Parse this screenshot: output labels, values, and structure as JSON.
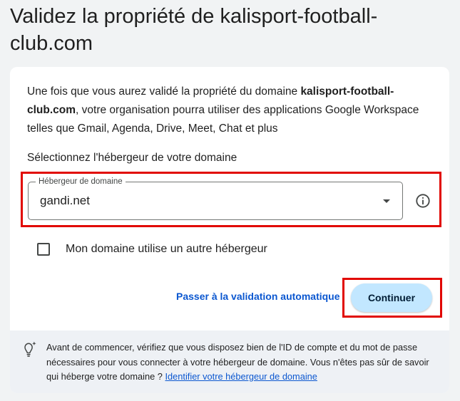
{
  "page": {
    "title": "Validez la propriété de kalisport-football-club.com"
  },
  "intro": {
    "before": "Une fois que vous aurez validé la propriété du domaine ",
    "domain": "kalisport-football-club.com",
    "after": ", votre organisation pourra utiliser des applications Google Workspace telles que Gmail, Agenda, Drive, Meet, Chat et plus"
  },
  "host_select": {
    "prompt": "Sélectionnez l'hébergeur de votre domaine",
    "label": "Hébergeur de domaine",
    "value": "gandi.net"
  },
  "other_host": {
    "label": "Mon domaine utilise un autre hébergeur",
    "checked": false
  },
  "actions": {
    "auto_validation_label": "Passer à la validation automatique",
    "continue_label": "Continuer"
  },
  "info": {
    "text": "Avant de commencer, vérifiez que vous disposez bien de l'ID de compte et du mot de passe nécessaires pour vous connecter à votre hébergeur de domaine. Vous n'êtes pas sûr de savoir qui héberge votre domaine ? ",
    "link": "Identifier votre hébergeur de domaine"
  },
  "colors": {
    "accent": "#0b57d0",
    "button_bg": "#c2e7ff",
    "highlight": "#e10600"
  },
  "icons": {
    "info": "info-circle-icon",
    "dropdown": "chevron-down-icon",
    "bulb": "lightbulb-icon"
  }
}
